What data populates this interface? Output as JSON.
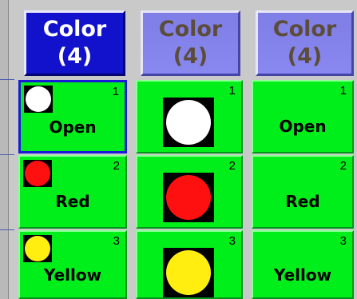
{
  "headers": [
    {
      "title": "Color",
      "count": "(4)"
    },
    {
      "title": "Color",
      "count": "(4)"
    },
    {
      "title": "Color",
      "count": "(4)"
    }
  ],
  "rows": [
    {
      "number": "1",
      "label": "Open",
      "color": "#ffffff"
    },
    {
      "number": "2",
      "label": "Red",
      "color": "#ff1010"
    },
    {
      "number": "3",
      "label": "Yellow",
      "color": "#ffee10"
    }
  ],
  "colors": {
    "active_header": "#1212cc",
    "inactive_header": "#8282ea",
    "cell_background": "#00ef1a",
    "selection_border": "#1a1ad8"
  }
}
